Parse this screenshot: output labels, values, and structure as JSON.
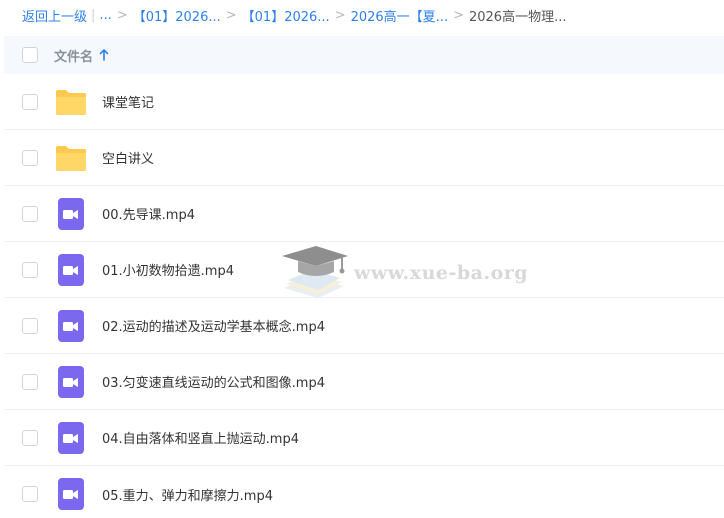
{
  "breadcrumb": {
    "back_label": "返回上一级",
    "ellipsis": "...",
    "items": [
      "【01】2026...",
      "【01】2026...",
      "2026高一【夏..."
    ],
    "current": "2026高一物理..."
  },
  "header": {
    "column_label": "文件名"
  },
  "files": [
    {
      "name": "课堂笔记",
      "type": "folder"
    },
    {
      "name": "空白讲义",
      "type": "folder"
    },
    {
      "name": "00.先导课.mp4",
      "type": "video"
    },
    {
      "name": "01.小初数物拾遗.mp4",
      "type": "video"
    },
    {
      "name": "02.运动的描述及运动学基本概念.mp4",
      "type": "video"
    },
    {
      "name": "03.匀变速直线运动的公式和图像.mp4",
      "type": "video"
    },
    {
      "name": "04.自由落体和竖直上抛运动.mp4",
      "type": "video"
    },
    {
      "name": "05.重力、弹力和摩擦力.mp4",
      "type": "video"
    }
  ],
  "watermark": {
    "text": "www.xue-ba.org"
  },
  "colors": {
    "link": "#2f80ed",
    "folder": "#ffc94d",
    "video": "#7b68ee",
    "header_bg": "#f5f9fd"
  }
}
